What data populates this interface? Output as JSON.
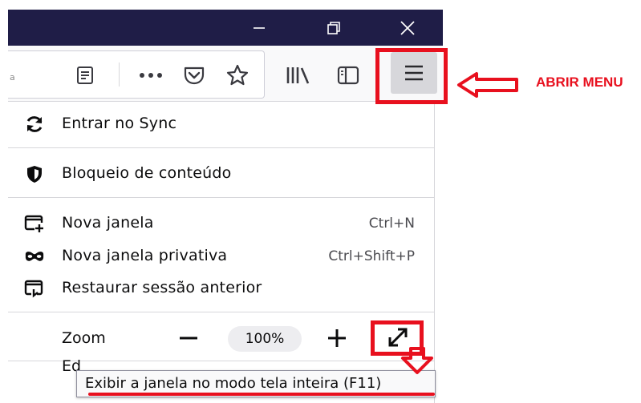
{
  "window_controls": {
    "minimize_icon": "minimize-icon",
    "restore_icon": "restore-icon",
    "close_icon": "close-icon"
  },
  "toolbar": {
    "urlbar_partial_char": "a",
    "icons": [
      "reader-view-icon",
      "more-actions-icon",
      "pocket-icon",
      "bookmark-star-icon",
      "library-icon",
      "sidebar-icon",
      "hamburger-menu-icon"
    ]
  },
  "menu": {
    "items": [
      {
        "label": "Entrar no Sync",
        "icon": "sync-icon",
        "shortcut": ""
      },
      {
        "label": "Bloqueio de conteúdo",
        "icon": "shield-icon",
        "shortcut": ""
      },
      {
        "label": "Nova janela",
        "icon": "new-window-icon",
        "shortcut": "Ctrl+N"
      },
      {
        "label": "Nova janela privativa",
        "icon": "private-mask-icon",
        "shortcut": "Ctrl+Shift+P"
      },
      {
        "label": "Restaurar sessão anterior",
        "icon": "restore-session-icon",
        "shortcut": ""
      }
    ],
    "zoom": {
      "label": "Zoom",
      "minus": "−",
      "value": "100%",
      "plus": "+"
    },
    "edit_partial": "Ed"
  },
  "tooltip": {
    "text": "Exibir a janela no modo tela inteira (F11)"
  },
  "annotation": {
    "label": "ABRIR MENU",
    "color": "#e8101e"
  },
  "colors": {
    "titlebar": "#1f1d47",
    "toolbar": "#f9f9fa",
    "accent_red": "#e8101e"
  }
}
